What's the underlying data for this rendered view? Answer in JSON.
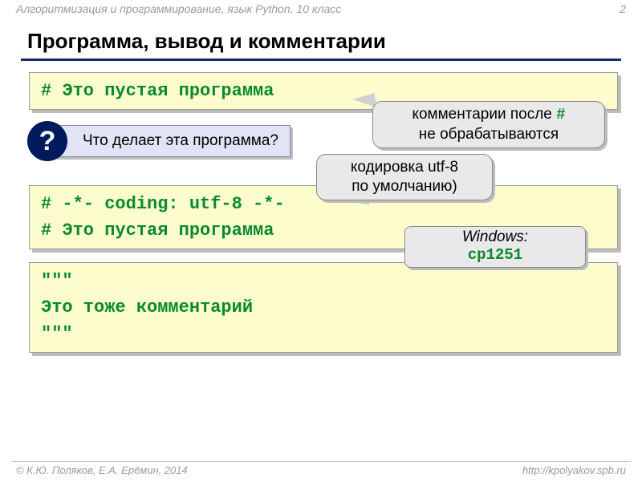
{
  "header": {
    "course": "Алгоритмизация и программирование, язык Python, 10 класс",
    "page_number": "2"
  },
  "title": "Программа, вывод и комментарии",
  "code1": {
    "line1": "# Это пустая программа"
  },
  "question": {
    "icon": "?",
    "text": "Что делает эта программа?"
  },
  "callout1": {
    "prefix": "комментарии после ",
    "hash": "#",
    "suffix": " не обрабатываются"
  },
  "callout2": {
    "line1": "кодировка utf-8",
    "line2": "по умолчанию)"
  },
  "code2": {
    "line1": "# -*- coding: utf-8 -*-",
    "line2": "# Это пустая программа"
  },
  "windows": {
    "label": "Windows:",
    "value": "cp1251"
  },
  "code3": {
    "line1": "\"\"\"",
    "line2": "Это тоже комментарий",
    "line3": "\"\"\""
  },
  "footer": {
    "copyright": "© К.Ю. Поляков, Е.А. Ерёмин, 2014",
    "url": "http://kpolyakov.spb.ru"
  }
}
